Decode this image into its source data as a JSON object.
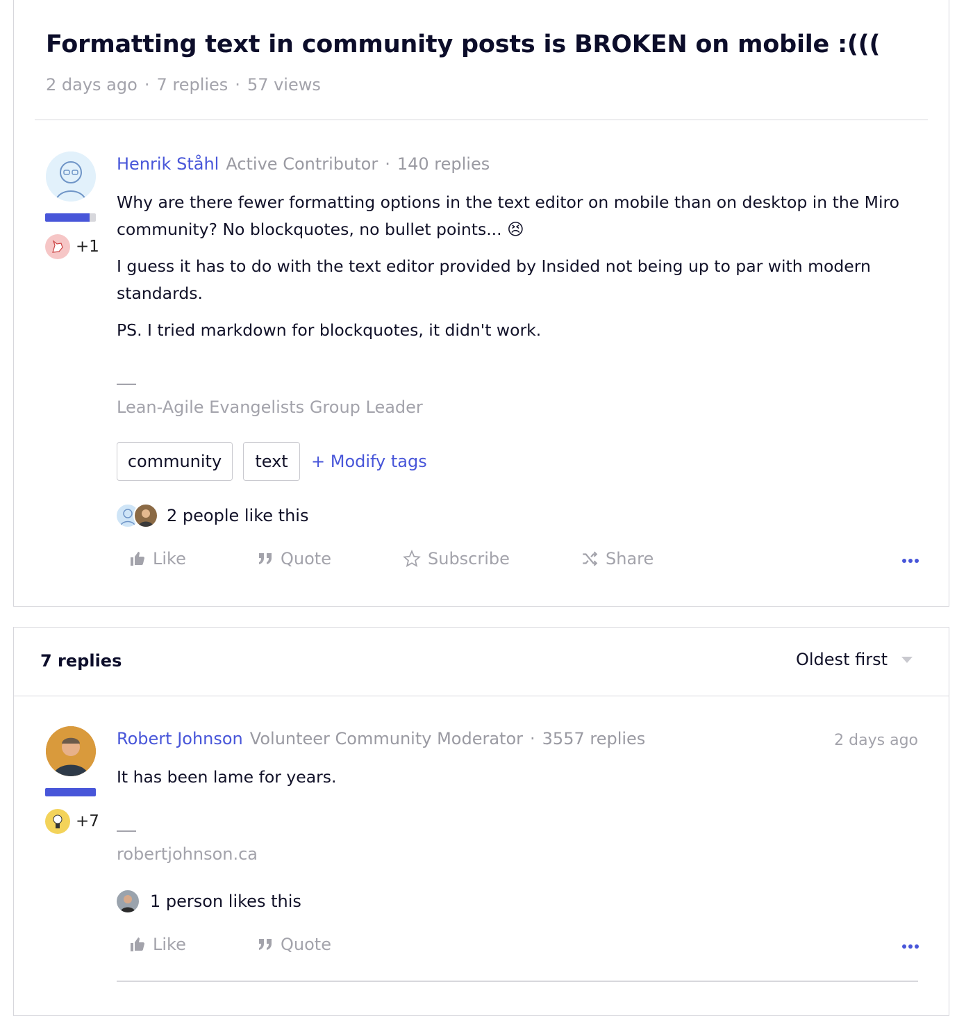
{
  "topic": {
    "title": "Formatting text in community posts is BROKEN on mobile :(((",
    "meta": {
      "posted": "2 days ago",
      "replies": "7 replies",
      "views": "57 views"
    },
    "post": {
      "author": {
        "name": "Henrik Ståhl",
        "rank": "Active Contributor",
        "reply_count": "140 replies",
        "badge_count": "+1"
      },
      "paragraphs": [
        "Why are there fewer formatting options in the text editor on mobile than on desktop in the Miro community? No blockquotes, no bullet points...",
        "I guess it has to do with the text editor provided by Insided not being up to par with modern standards.",
        "PS. I tried markdown for blockquotes, it didn't work."
      ],
      "emoji": "😣",
      "signature": "Lean-Agile Evangelists Group Leader",
      "tags": [
        "community",
        "text"
      ],
      "modify_tags_label": "+ Modify tags",
      "likes_text": "2 people like this",
      "actions": {
        "like": "Like",
        "quote": "Quote",
        "subscribe": "Subscribe",
        "share": "Share"
      }
    }
  },
  "replies_section": {
    "heading": "7 replies",
    "sort_label": "Oldest first",
    "reply": {
      "author": {
        "name": "Robert Johnson",
        "rank": "Volunteer Community Moderator",
        "reply_count": "3557 replies",
        "badge_count": "+7"
      },
      "time": "2 days ago",
      "text": "It has been lame for years.",
      "signature": "robertjohnson.ca",
      "likes_text": "1 person likes this",
      "actions": {
        "like": "Like",
        "quote": "Quote"
      }
    }
  },
  "colors": {
    "accent": "#4856d9",
    "muted": "#a3a3ab",
    "title": "#0c0d2a",
    "border": "#d7d7dc"
  },
  "icons": [
    "thumbs-up-icon",
    "quote-icon",
    "star-icon",
    "shuffle-share-icon",
    "more-dots-icon",
    "unicorn-badge-icon",
    "medal-badge-icon",
    "chevron-down-icon"
  ]
}
